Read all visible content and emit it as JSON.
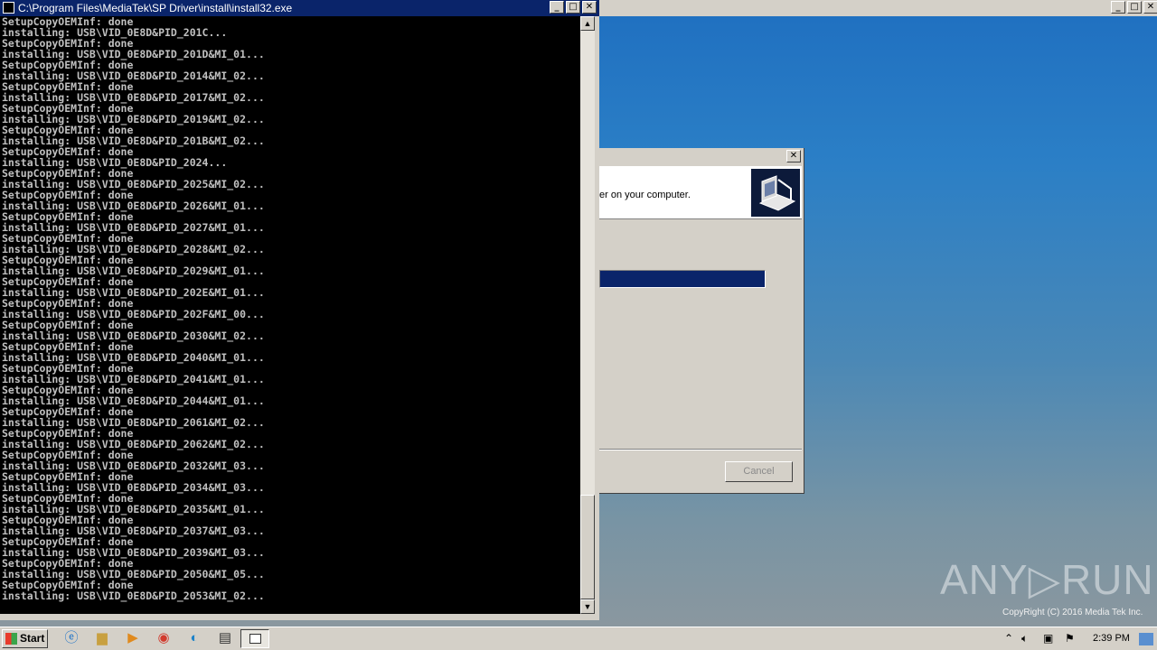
{
  "console": {
    "title": "C:\\Program Files\\MediaTek\\SP Driver\\install\\install32.exe",
    "lines": [
      "SetupCopyOEMInf: done",
      "installing: USB\\VID_0E8D&PID_201C...",
      "SetupCopyOEMInf: done",
      "installing: USB\\VID_0E8D&PID_201D&MI_01...",
      "SetupCopyOEMInf: done",
      "installing: USB\\VID_0E8D&PID_2014&MI_02...",
      "SetupCopyOEMInf: done",
      "installing: USB\\VID_0E8D&PID_2017&MI_02...",
      "SetupCopyOEMInf: done",
      "installing: USB\\VID_0E8D&PID_2019&MI_02...",
      "SetupCopyOEMInf: done",
      "installing: USB\\VID_0E8D&PID_201B&MI_02...",
      "SetupCopyOEMInf: done",
      "installing: USB\\VID_0E8D&PID_2024...",
      "SetupCopyOEMInf: done",
      "installing: USB\\VID_0E8D&PID_2025&MI_02...",
      "SetupCopyOEMInf: done",
      "installing: USB\\VID_0E8D&PID_2026&MI_01...",
      "SetupCopyOEMInf: done",
      "installing: USB\\VID_0E8D&PID_2027&MI_01...",
      "SetupCopyOEMInf: done",
      "installing: USB\\VID_0E8D&PID_2028&MI_02...",
      "SetupCopyOEMInf: done",
      "installing: USB\\VID_0E8D&PID_2029&MI_01...",
      "SetupCopyOEMInf: done",
      "installing: USB\\VID_0E8D&PID_202E&MI_01...",
      "SetupCopyOEMInf: done",
      "installing: USB\\VID_0E8D&PID_202F&MI_00...",
      "SetupCopyOEMInf: done",
      "installing: USB\\VID_0E8D&PID_2030&MI_02...",
      "SetupCopyOEMInf: done",
      "installing: USB\\VID_0E8D&PID_2040&MI_01...",
      "SetupCopyOEMInf: done",
      "installing: USB\\VID_0E8D&PID_2041&MI_01...",
      "SetupCopyOEMInf: done",
      "installing: USB\\VID_0E8D&PID_2044&MI_01...",
      "SetupCopyOEMInf: done",
      "installing: USB\\VID_0E8D&PID_2061&MI_02...",
      "SetupCopyOEMInf: done",
      "installing: USB\\VID_0E8D&PID_2062&MI_02...",
      "SetupCopyOEMInf: done",
      "installing: USB\\VID_0E8D&PID_2032&MI_03...",
      "SetupCopyOEMInf: done",
      "installing: USB\\VID_0E8D&PID_2034&MI_03...",
      "SetupCopyOEMInf: done",
      "installing: USB\\VID_0E8D&PID_2035&MI_01...",
      "SetupCopyOEMInf: done",
      "installing: USB\\VID_0E8D&PID_2037&MI_03...",
      "SetupCopyOEMInf: done",
      "installing: USB\\VID_0E8D&PID_2039&MI_03...",
      "SetupCopyOEMInf: done",
      "installing: USB\\VID_0E8D&PID_2050&MI_05...",
      "SetupCopyOEMInf: done",
      "installing: USB\\VID_0E8D&PID_2053&MI_02..."
    ],
    "window_buttons": {
      "minimize": "_",
      "maximize": "□",
      "close": "✕"
    },
    "icons": {
      "window": "console-app-icon",
      "scroll_up": "arrow-up-icon",
      "scroll_down": "arrow-down-icon"
    }
  },
  "installer_dialog": {
    "header_text": "er on your computer.",
    "cancel_label": "Cancel",
    "close_symbol": "✕",
    "header_icon": "installer-computer-icon",
    "progress_fill": 1.0
  },
  "background_window": {
    "window_buttons": {
      "minimize": "_",
      "maximize": "□",
      "close": "✕"
    }
  },
  "watermark": {
    "text": "ANY▷RUN",
    "copyright": "CopyRight (C) 2016 Media Tek Inc."
  },
  "taskbar": {
    "start_label": "Start",
    "apps": [
      "ie-icon",
      "explorer-folder-icon",
      "media-player-icon",
      "chrome-icon",
      "edge-icon",
      "installer-icon",
      "console-icon"
    ],
    "tray_icons": [
      "tray-expand-icon",
      "volume-icon",
      "network-icon",
      "flag-icon"
    ],
    "clock": "2:39 PM"
  },
  "colors": {
    "titlebar_active": "#0a246a",
    "dialog_bg": "#d4d0c8",
    "console_bg": "#000000",
    "console_text": "#c0c0c0"
  }
}
